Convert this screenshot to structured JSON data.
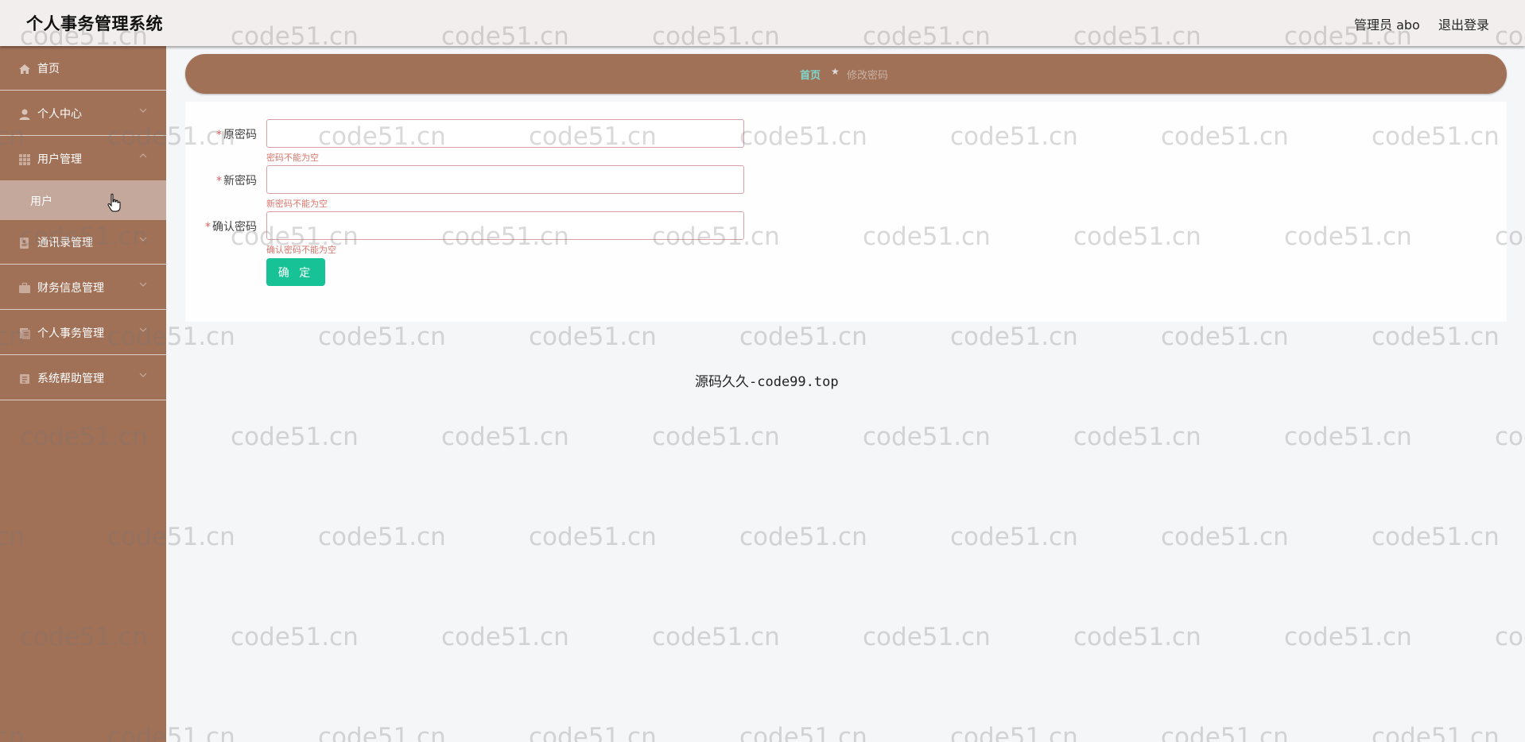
{
  "header": {
    "app_title": "个人事务管理系统",
    "user_label": "管理员 abo",
    "logout_label": "退出登录"
  },
  "sidebar": {
    "items": [
      {
        "label": "首页",
        "icon": "home-icon",
        "expandable": false
      },
      {
        "label": "个人中心",
        "icon": "user-icon",
        "expandable": true,
        "expanded": false
      },
      {
        "label": "用户管理",
        "icon": "grid-icon",
        "expandable": true,
        "expanded": true
      },
      {
        "label": "通讯录管理",
        "icon": "contacts-icon",
        "expandable": true,
        "expanded": false
      },
      {
        "label": "财务信息管理",
        "icon": "briefcase-icon",
        "expandable": true,
        "expanded": false
      },
      {
        "label": "个人事务管理",
        "icon": "document-icon",
        "expandable": true,
        "expanded": false
      },
      {
        "label": "系统帮助管理",
        "icon": "help-icon",
        "expandable": true,
        "expanded": false
      }
    ],
    "submenu": {
      "label": "用户",
      "active": true
    }
  },
  "breadcrumb": {
    "home": "首页",
    "separator": "★",
    "current": "修改密码"
  },
  "form": {
    "fields": [
      {
        "label": "原密码",
        "required": true,
        "value": "",
        "error": "密码不能为空"
      },
      {
        "label": "新密码",
        "required": true,
        "value": "",
        "error": "新密码不能为空"
      },
      {
        "label": "确认密码",
        "required": true,
        "value": "",
        "error": "确认密码不能为空"
      }
    ],
    "submit_label": "确 定"
  },
  "footer": {
    "text": "源码久久-code99.top"
  },
  "watermark": {
    "text": "code51.cn"
  },
  "colors": {
    "sidebar": "#a17157",
    "header": "#f3eeee",
    "submit": "#17c296",
    "error": "#d9776f",
    "breadcrumb_home": "#7dd8d0"
  }
}
